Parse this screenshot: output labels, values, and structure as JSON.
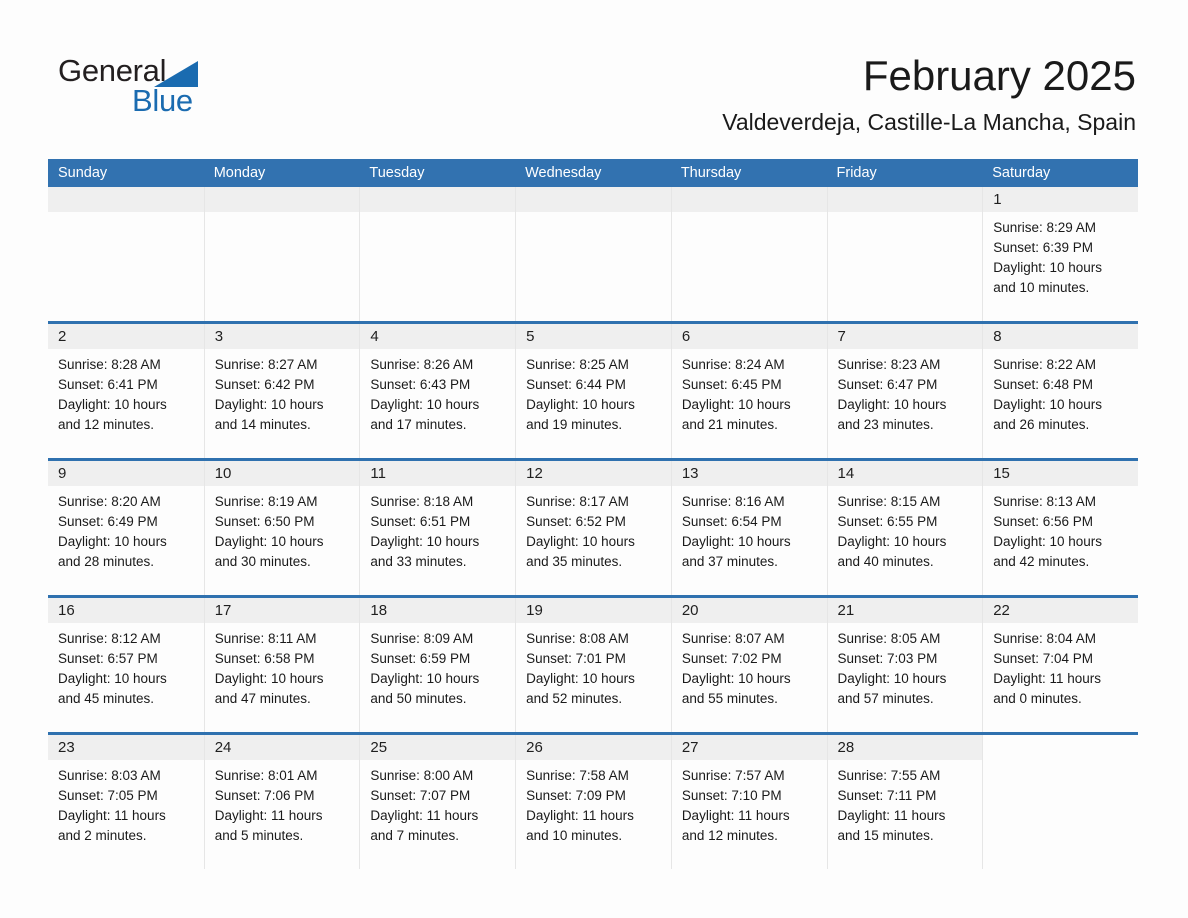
{
  "brand": {
    "name_part1": "General",
    "name_part2": "Blue",
    "triangle_icon": "triangle-icon",
    "accent_color": "#1a6bb0"
  },
  "header": {
    "month_title": "February 2025",
    "location": "Valdeverdeja, Castille-La Mancha, Spain"
  },
  "colors": {
    "header_blue": "#3272b0",
    "row_divider_blue": "#2f71af",
    "day_band_gray": "#efefef"
  },
  "weekday_headers": [
    "Sunday",
    "Monday",
    "Tuesday",
    "Wednesday",
    "Thursday",
    "Friday",
    "Saturday"
  ],
  "weeks": [
    [
      {
        "day": "",
        "sunrise": "",
        "sunset": "",
        "daylight_line1": "",
        "daylight_line2": "",
        "empty": true
      },
      {
        "day": "",
        "sunrise": "",
        "sunset": "",
        "daylight_line1": "",
        "daylight_line2": "",
        "empty": true
      },
      {
        "day": "",
        "sunrise": "",
        "sunset": "",
        "daylight_line1": "",
        "daylight_line2": "",
        "empty": true
      },
      {
        "day": "",
        "sunrise": "",
        "sunset": "",
        "daylight_line1": "",
        "daylight_line2": "",
        "empty": true
      },
      {
        "day": "",
        "sunrise": "",
        "sunset": "",
        "daylight_line1": "",
        "daylight_line2": "",
        "empty": true
      },
      {
        "day": "",
        "sunrise": "",
        "sunset": "",
        "daylight_line1": "",
        "daylight_line2": "",
        "empty": true
      },
      {
        "day": "1",
        "sunrise": "Sunrise: 8:29 AM",
        "sunset": "Sunset: 6:39 PM",
        "daylight_line1": "Daylight: 10 hours",
        "daylight_line2": "and 10 minutes.",
        "empty": false
      }
    ],
    [
      {
        "day": "2",
        "sunrise": "Sunrise: 8:28 AM",
        "sunset": "Sunset: 6:41 PM",
        "daylight_line1": "Daylight: 10 hours",
        "daylight_line2": "and 12 minutes.",
        "empty": false
      },
      {
        "day": "3",
        "sunrise": "Sunrise: 8:27 AM",
        "sunset": "Sunset: 6:42 PM",
        "daylight_line1": "Daylight: 10 hours",
        "daylight_line2": "and 14 minutes.",
        "empty": false
      },
      {
        "day": "4",
        "sunrise": "Sunrise: 8:26 AM",
        "sunset": "Sunset: 6:43 PM",
        "daylight_line1": "Daylight: 10 hours",
        "daylight_line2": "and 17 minutes.",
        "empty": false
      },
      {
        "day": "5",
        "sunrise": "Sunrise: 8:25 AM",
        "sunset": "Sunset: 6:44 PM",
        "daylight_line1": "Daylight: 10 hours",
        "daylight_line2": "and 19 minutes.",
        "empty": false
      },
      {
        "day": "6",
        "sunrise": "Sunrise: 8:24 AM",
        "sunset": "Sunset: 6:45 PM",
        "daylight_line1": "Daylight: 10 hours",
        "daylight_line2": "and 21 minutes.",
        "empty": false
      },
      {
        "day": "7",
        "sunrise": "Sunrise: 8:23 AM",
        "sunset": "Sunset: 6:47 PM",
        "daylight_line1": "Daylight: 10 hours",
        "daylight_line2": "and 23 minutes.",
        "empty": false
      },
      {
        "day": "8",
        "sunrise": "Sunrise: 8:22 AM",
        "sunset": "Sunset: 6:48 PM",
        "daylight_line1": "Daylight: 10 hours",
        "daylight_line2": "and 26 minutes.",
        "empty": false
      }
    ],
    [
      {
        "day": "9",
        "sunrise": "Sunrise: 8:20 AM",
        "sunset": "Sunset: 6:49 PM",
        "daylight_line1": "Daylight: 10 hours",
        "daylight_line2": "and 28 minutes.",
        "empty": false
      },
      {
        "day": "10",
        "sunrise": "Sunrise: 8:19 AM",
        "sunset": "Sunset: 6:50 PM",
        "daylight_line1": "Daylight: 10 hours",
        "daylight_line2": "and 30 minutes.",
        "empty": false
      },
      {
        "day": "11",
        "sunrise": "Sunrise: 8:18 AM",
        "sunset": "Sunset: 6:51 PM",
        "daylight_line1": "Daylight: 10 hours",
        "daylight_line2": "and 33 minutes.",
        "empty": false
      },
      {
        "day": "12",
        "sunrise": "Sunrise: 8:17 AM",
        "sunset": "Sunset: 6:52 PM",
        "daylight_line1": "Daylight: 10 hours",
        "daylight_line2": "and 35 minutes.",
        "empty": false
      },
      {
        "day": "13",
        "sunrise": "Sunrise: 8:16 AM",
        "sunset": "Sunset: 6:54 PM",
        "daylight_line1": "Daylight: 10 hours",
        "daylight_line2": "and 37 minutes.",
        "empty": false
      },
      {
        "day": "14",
        "sunrise": "Sunrise: 8:15 AM",
        "sunset": "Sunset: 6:55 PM",
        "daylight_line1": "Daylight: 10 hours",
        "daylight_line2": "and 40 minutes.",
        "empty": false
      },
      {
        "day": "15",
        "sunrise": "Sunrise: 8:13 AM",
        "sunset": "Sunset: 6:56 PM",
        "daylight_line1": "Daylight: 10 hours",
        "daylight_line2": "and 42 minutes.",
        "empty": false
      }
    ],
    [
      {
        "day": "16",
        "sunrise": "Sunrise: 8:12 AM",
        "sunset": "Sunset: 6:57 PM",
        "daylight_line1": "Daylight: 10 hours",
        "daylight_line2": "and 45 minutes.",
        "empty": false
      },
      {
        "day": "17",
        "sunrise": "Sunrise: 8:11 AM",
        "sunset": "Sunset: 6:58 PM",
        "daylight_line1": "Daylight: 10 hours",
        "daylight_line2": "and 47 minutes.",
        "empty": false
      },
      {
        "day": "18",
        "sunrise": "Sunrise: 8:09 AM",
        "sunset": "Sunset: 6:59 PM",
        "daylight_line1": "Daylight: 10 hours",
        "daylight_line2": "and 50 minutes.",
        "empty": false
      },
      {
        "day": "19",
        "sunrise": "Sunrise: 8:08 AM",
        "sunset": "Sunset: 7:01 PM",
        "daylight_line1": "Daylight: 10 hours",
        "daylight_line2": "and 52 minutes.",
        "empty": false
      },
      {
        "day": "20",
        "sunrise": "Sunrise: 8:07 AM",
        "sunset": "Sunset: 7:02 PM",
        "daylight_line1": "Daylight: 10 hours",
        "daylight_line2": "and 55 minutes.",
        "empty": false
      },
      {
        "day": "21",
        "sunrise": "Sunrise: 8:05 AM",
        "sunset": "Sunset: 7:03 PM",
        "daylight_line1": "Daylight: 10 hours",
        "daylight_line2": "and 57 minutes.",
        "empty": false
      },
      {
        "day": "22",
        "sunrise": "Sunrise: 8:04 AM",
        "sunset": "Sunset: 7:04 PM",
        "daylight_line1": "Daylight: 11 hours",
        "daylight_line2": "and 0 minutes.",
        "empty": false
      }
    ],
    [
      {
        "day": "23",
        "sunrise": "Sunrise: 8:03 AM",
        "sunset": "Sunset: 7:05 PM",
        "daylight_line1": "Daylight: 11 hours",
        "daylight_line2": "and 2 minutes.",
        "empty": false
      },
      {
        "day": "24",
        "sunrise": "Sunrise: 8:01 AM",
        "sunset": "Sunset: 7:06 PM",
        "daylight_line1": "Daylight: 11 hours",
        "daylight_line2": "and 5 minutes.",
        "empty": false
      },
      {
        "day": "25",
        "sunrise": "Sunrise: 8:00 AM",
        "sunset": "Sunset: 7:07 PM",
        "daylight_line1": "Daylight: 11 hours",
        "daylight_line2": "and 7 minutes.",
        "empty": false
      },
      {
        "day": "26",
        "sunrise": "Sunrise: 7:58 AM",
        "sunset": "Sunset: 7:09 PM",
        "daylight_line1": "Daylight: 11 hours",
        "daylight_line2": "and 10 minutes.",
        "empty": false
      },
      {
        "day": "27",
        "sunrise": "Sunrise: 7:57 AM",
        "sunset": "Sunset: 7:10 PM",
        "daylight_line1": "Daylight: 11 hours",
        "daylight_line2": "and 12 minutes.",
        "empty": false
      },
      {
        "day": "28",
        "sunrise": "Sunrise: 7:55 AM",
        "sunset": "Sunset: 7:11 PM",
        "daylight_line1": "Daylight: 11 hours",
        "daylight_line2": "and 15 minutes.",
        "empty": false
      },
      {
        "day": "",
        "sunrise": "",
        "sunset": "",
        "daylight_line1": "",
        "daylight_line2": "",
        "empty": true,
        "void": true
      }
    ]
  ]
}
